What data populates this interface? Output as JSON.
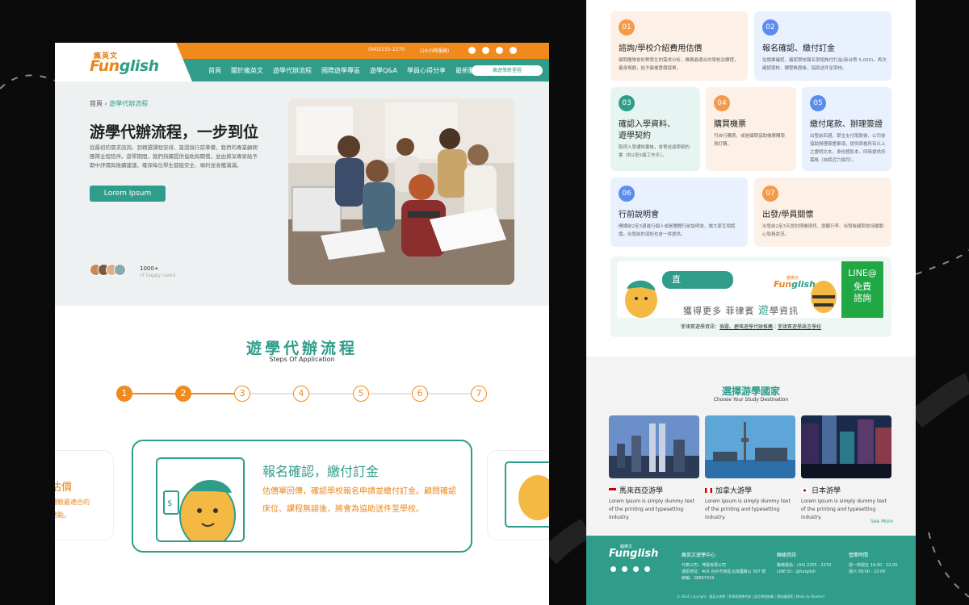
{
  "colors": {
    "brand_teal": "#2f9d8a",
    "brand_orange": "#f08a1c",
    "line_green": "#21a845",
    "background": "#0b0b0b"
  },
  "left_page": {
    "topbar": {
      "phone": "(04)2255-2270",
      "hours": "(24小時服務)",
      "social_icons": [
        "line-icon",
        "facebook-icon",
        "instagram-icon",
        "youtube-icon"
      ]
    },
    "logo": {
      "small": "瘋英文",
      "main_prefix": "Fun",
      "main_suffix": "glish"
    },
    "nav": {
      "items": [
        "首頁",
        "關於瘋英文",
        "遊學代辦流程",
        "國際遊學專區",
        "遊學Q&A",
        "學員心得分享",
        "最新動態"
      ],
      "button": "瘋遊學新里程"
    },
    "hero": {
      "breadcrumb_home": "首頁",
      "breadcrumb_sep": "›",
      "breadcrumb_current": "遊學代辦流程",
      "title": "游學代辦流程，一步到位",
      "description": "從最初的需求諮詢、到精選課程安排、簽證與行前準備，我們的專業顧問團隊全程陪伴。遊學期間，我們持續提供協助與關懷，並由資深專家給予期中評價與後續建議，確保每位學生都能安全、順利並收穫滿滿。",
      "button": "Lorem Ipsum",
      "happy_count": "1000+",
      "happy_label": "of happy users"
    },
    "steps": {
      "title": "遊學代辦流程",
      "subtitle": "Steps Of Application",
      "numbers": [
        "1",
        "2",
        "3",
        "4",
        "5",
        "6",
        "7"
      ],
      "active_count": 2
    },
    "step_card": {
      "prev_title": "估價",
      "prev_lines": [
        "體驗最適合的",
        "地點。"
      ],
      "title": "報名確認，繳付訂金",
      "text": "估價單回傳，確認學校報名申請並繳付訂金。顧問確認床位、課程無誤後，將會為協助送件至學校。"
    }
  },
  "right_page": {
    "process_cards": [
      {
        "num": "01",
        "title": "諮詢/學校介紹費用估價",
        "text": "顧問團隊會針對學生的需求分析，推薦最適合的學校及課程，量身規劃，給予最優惠價錢單。",
        "color": "#f49a4a"
      },
      {
        "num": "02",
        "title": "報名確認、繳付訂金",
        "text": "估價單確認，確認學校報名學諮詢付訂金(新台幣 5,000)，再次確認學校、課程無誤後，協助送件至學校。",
        "color": "#5b8def"
      },
      {
        "num": "03",
        "title_lines": [
          "確認入學資料、",
          "遊學契約"
        ],
        "text": "取得入學通知書後，會寄送遊學契約書（約2至5個工作天）。",
        "color": "#2f9d8a"
      },
      {
        "num": "04",
        "title": "購買機票",
        "text": "可自行購買，或是顧問協助機票購學員訂購。",
        "color": "#f49a4a"
      },
      {
        "num": "05",
        "title": "繳付尾款、辦理簽證",
        "text": "出發前四週，學生支付尾款後，公司會協助辦理簽證事項，提供資格所有以上之證明文本，身份證影本，同時提供所需格（自認近六個月）。",
        "color": "#5b8def"
      },
      {
        "num": "06",
        "title": "行前說明會",
        "text": "開課前2至3週進行個人或是團體行前說明會，讓大家互相認識，出發前的須知也會一併提供。",
        "color": "#5b8def"
      },
      {
        "num": "07",
        "title": "出發/學員關懷",
        "text": "出發前2至3天提供搭機資訊、提醒行李、出發後顧問會持續關心學員狀況。",
        "color": "#f49a4a"
      }
    ],
    "line_banner": {
      "bubble": "直",
      "text_prefix": "獲得更多 菲律賓",
      "text_highlight": "遊",
      "text_highlight2": "學",
      "text_suffix": "資訊",
      "logo_small": "瘋英文",
      "logo_prefix": "Fun",
      "logo_suffix": "glish",
      "line_title": "LINE@",
      "line_sub1": "免費",
      "line_sub2": "諮詢",
      "foot_prefix": "菲律賓遊學資訊：",
      "foot_link1": "宿霧、碧瑤遊學代辦推薦",
      "foot_sep": "｜",
      "foot_link2": "菲律賓遊學語言學校"
    },
    "destinations": {
      "title": "選擇游學國家",
      "subtitle": "Choose Your Study Destination",
      "items": [
        {
          "name": "馬來西亞游學",
          "desc": "Lorem Ipsum is simply dummy text of the printing and typesetting industry.",
          "flag": "malaysia-flag-icon"
        },
        {
          "name": "加拿大游學",
          "desc": "Lorem Ipsum is simply dummy text of the printing and typesetting industry.",
          "flag": "canada-flag-icon"
        },
        {
          "name": "日本游學",
          "desc": "Lorem Ipsum is simply dummy text of the printing and typesetting industry.",
          "flag": "japan-flag-icon"
        }
      ],
      "see_more": "See More"
    },
    "footer": {
      "logo_small": "瘋英文",
      "logo": "Funglish",
      "company": "瘋英文遊學中心",
      "company_lines": [
        "代表公司：坤賓有限公司",
        "通訊地址：40X 台中市南區北四國路以 397 號",
        "統編：28897419"
      ],
      "contact_title": "聯絡資訊",
      "contact_lines": [
        "聯絡電話：(04) 2255 - 2270",
        "LINE ID：@funglish"
      ],
      "hours_title": "營業時間",
      "hours_lines": [
        "週一到週五 14:00 - 22:00",
        "週六 09:00 - 22:00"
      ],
      "copyright": "© 2024 Copyright · 瘋英文遊學 | 菲律賓遊學代辦 | 語言學校推薦 | 隱私權政策 | Made by Bluetech"
    }
  }
}
